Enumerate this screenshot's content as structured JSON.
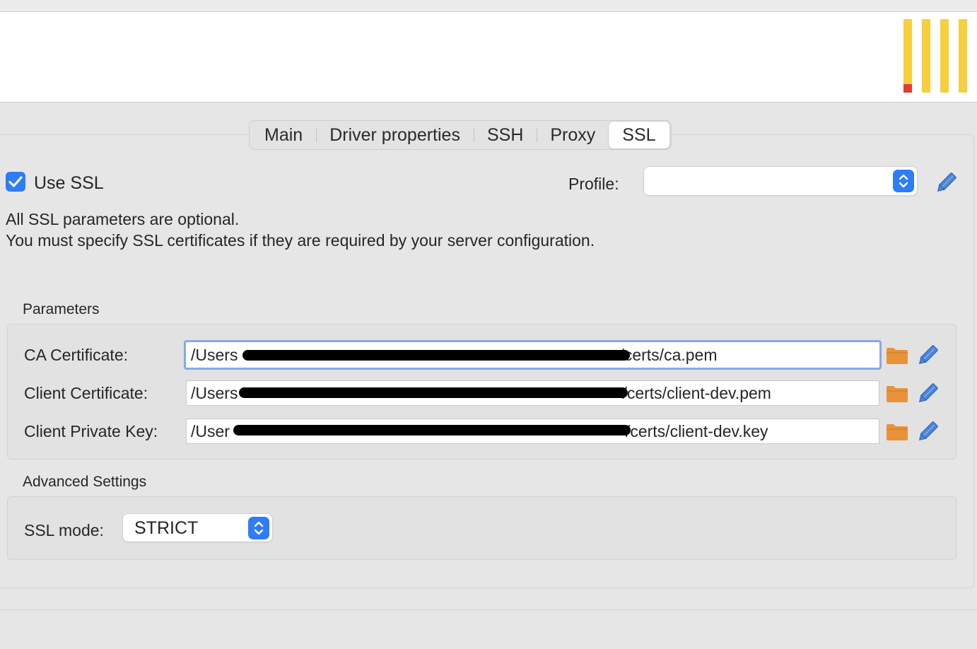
{
  "tabs": [
    {
      "label": "Main"
    },
    {
      "label": "Driver properties"
    },
    {
      "label": "SSH"
    },
    {
      "label": "Proxy"
    },
    {
      "label": "SSL",
      "active": true
    }
  ],
  "use_ssl": {
    "label": "Use SSL",
    "checked": true
  },
  "profile": {
    "label": "Profile:",
    "value": ""
  },
  "info": {
    "line1": "All SSL parameters are optional.",
    "line2": "You must specify SSL certificates if they are required by your server configuration."
  },
  "parameters": {
    "title": "Parameters",
    "fields": [
      {
        "label": "CA Certificate:",
        "value_start": "/Users",
        "value_end": "/certs/ca.pem"
      },
      {
        "label": "Client Certificate:",
        "value_start": "/Users",
        "value_end": "/certs/client-dev.pem"
      },
      {
        "label": "Client Private Key:",
        "value_start": "/User",
        "value_end": "/certs/client-dev.key"
      }
    ]
  },
  "advanced": {
    "title": "Advanced Settings",
    "ssl_mode_label": "SSL mode:",
    "ssl_mode_value": "STRICT"
  },
  "colors": {
    "accent": "#2e7cf6",
    "folder": "#e8923a",
    "pencil": "#4a86d9",
    "logo_bars": "#f7cf3c",
    "logo_red": "#e33b2f"
  }
}
